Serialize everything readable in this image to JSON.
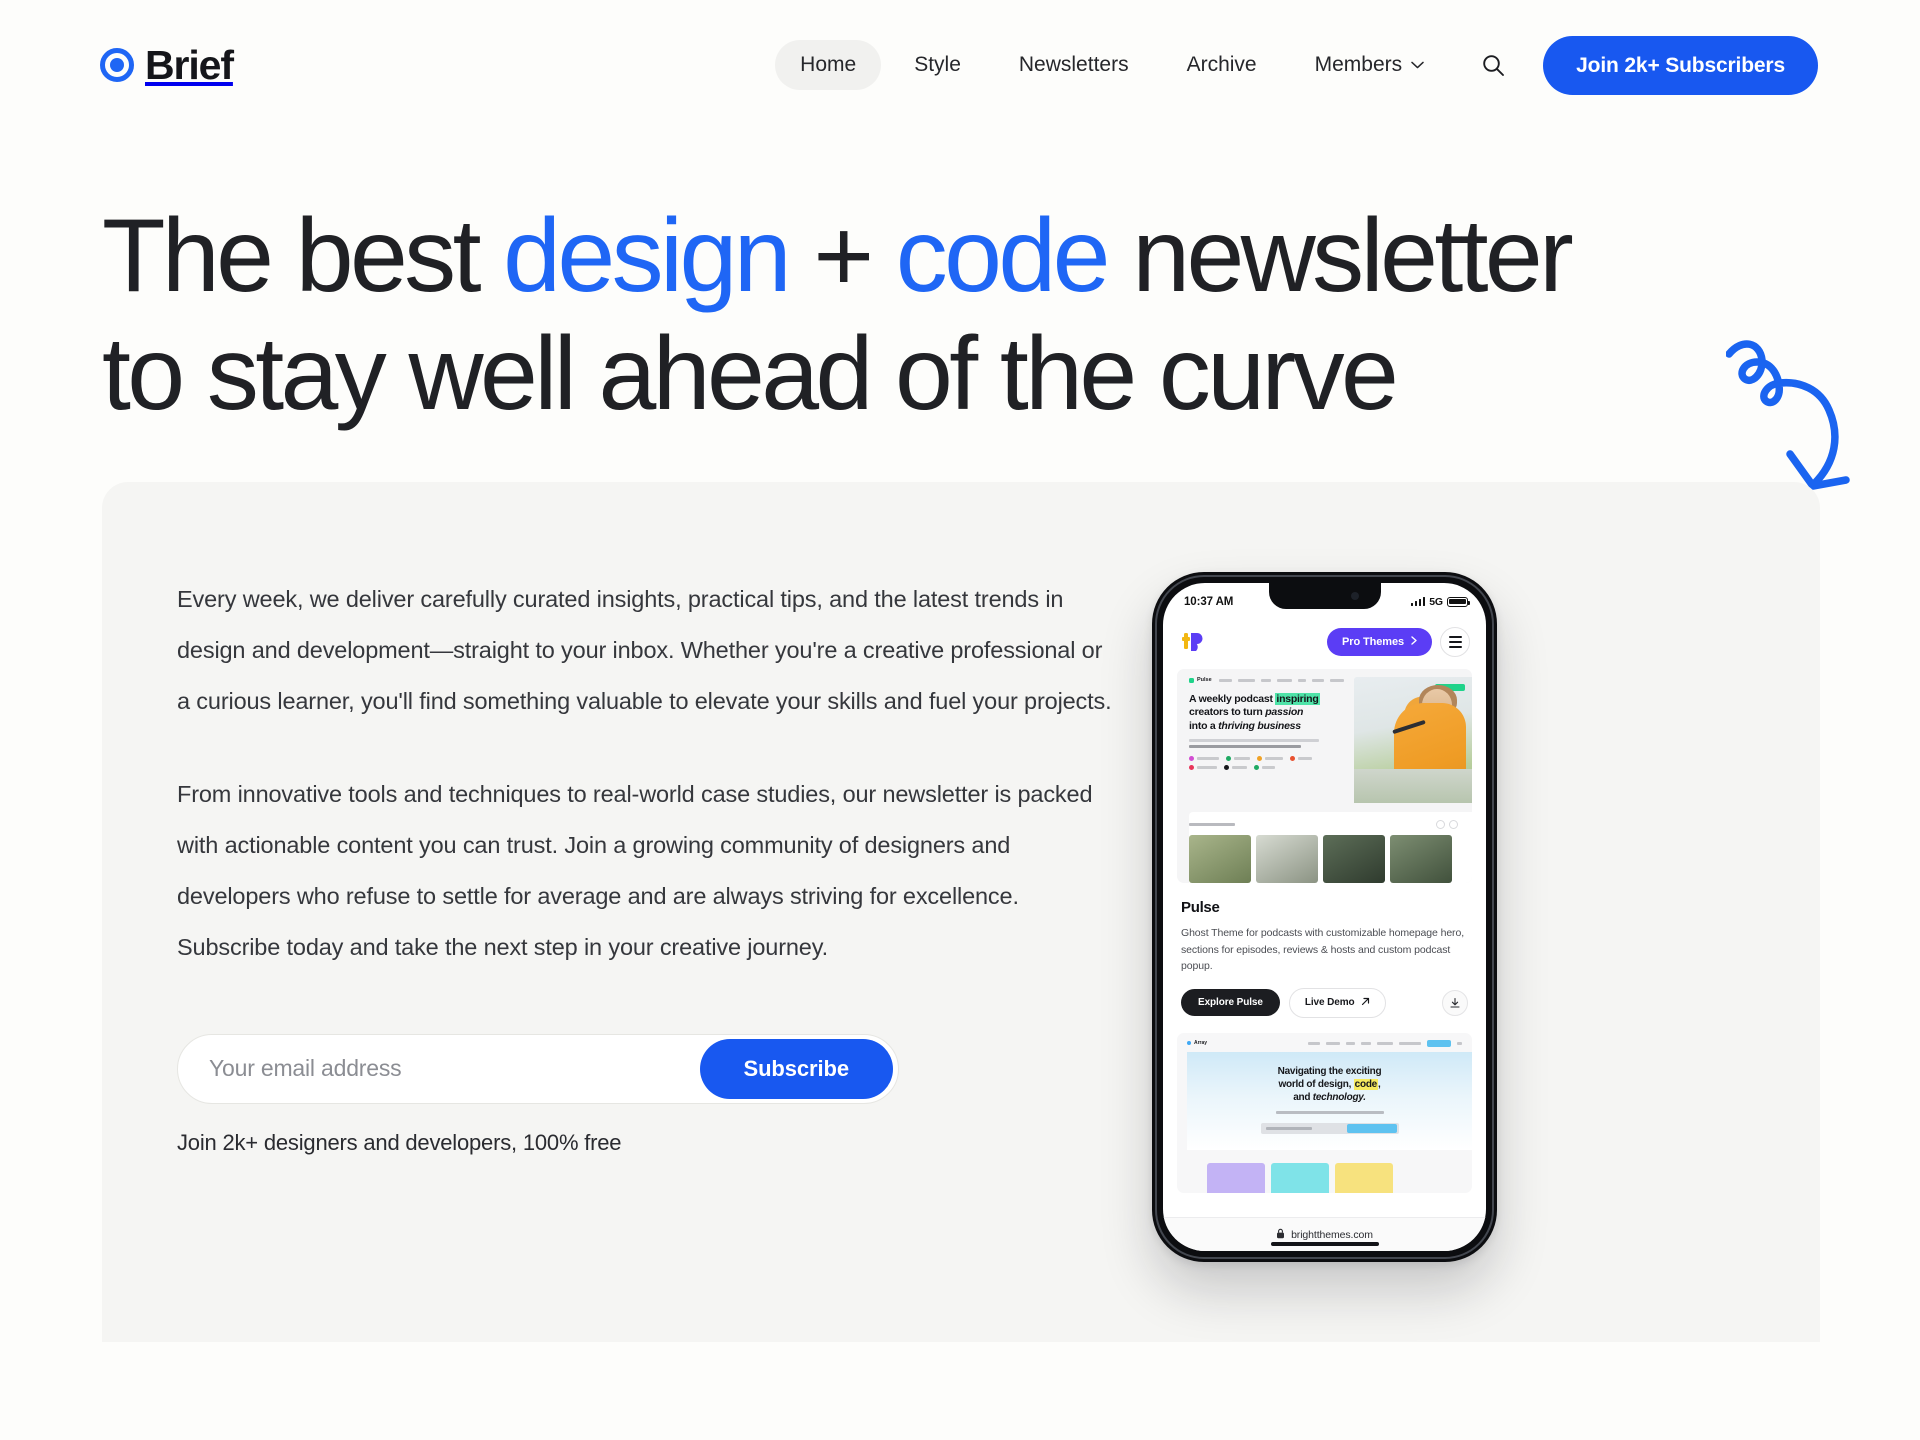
{
  "brand": {
    "name": "Brief",
    "mark": "ring-dot-logo",
    "color": "#1f66f5"
  },
  "nav": {
    "items": [
      {
        "label": "Home",
        "active": true
      },
      {
        "label": "Style",
        "active": false
      },
      {
        "label": "Newsletters",
        "active": false
      },
      {
        "label": "Archive",
        "active": false
      },
      {
        "label": "Members",
        "active": false,
        "has_dropdown": true
      }
    ],
    "search_icon": "search-icon",
    "cta_label": "Join 2k+ Subscribers",
    "cta_color": "#1858f0"
  },
  "hero": {
    "headline": {
      "part1": "The best ",
      "accent1": "design",
      "part2": " + ",
      "accent2": "code",
      "part3": " newsletter",
      "line2": "to stay well ahead of the curve"
    },
    "accent_color": "#1f66f5",
    "doodle": "curly-arrow-icon",
    "paragraph1": "Every week, we deliver carefully curated insights, practical tips, and the latest trends in design and development—straight to your inbox. Whether you're a creative professional or a curious learner, you'll find something valuable to elevate your skills and fuel your projects.",
    "paragraph2": "From innovative tools and techniques to real-world case studies, our newsletter is packed with actionable content you can trust. Join a growing community of designers and developers who refuse to settle for average and are always striving for excellence. Subscribe today and take the next step in your creative journey.",
    "form": {
      "email_placeholder": "Your email address",
      "email_value": "",
      "submit_label": "Subscribe",
      "note": "Join 2k+ designers and developers, 100% free"
    }
  },
  "phone": {
    "status": {
      "time": "10:37 AM",
      "network": "5G",
      "signal_icon": "signal-bars-icon",
      "battery_icon": "battery-icon"
    },
    "app_bar": {
      "logo": "brightthemes-logo-icon",
      "pro_label": "Pro Themes",
      "pro_chevron": "chevron-right-icon",
      "menu_icon": "hamburger-menu-icon"
    },
    "preview": {
      "site_name": "Pulse",
      "hero_line1_a": "A weekly podcast ",
      "hero_line1_hl": "inspiring",
      "hero_line2_a": "creators to turn ",
      "hero_line2_em": "passion",
      "hero_line3_a": "into a ",
      "hero_line3_em": "thriving business"
    },
    "theme": {
      "title": "Pulse",
      "description": "Ghost Theme for podcasts with customizable homepage hero, sections for episodes, reviews & hosts and custom podcast popup.",
      "primary_label": "Explore Pulse",
      "secondary_label": "Live Demo",
      "secondary_icon": "external-link-icon",
      "download_icon": "download-icon"
    },
    "preview2": {
      "hero_line1": "Navigating the exciting",
      "hero_line2_a": "world of design, ",
      "hero_line2_hl": "code",
      "hero_line2_b": ",",
      "hero_line3_a": "and ",
      "hero_line3_em": "technology."
    },
    "url": "brightthemes.com",
    "lock_icon": "lock-icon"
  }
}
